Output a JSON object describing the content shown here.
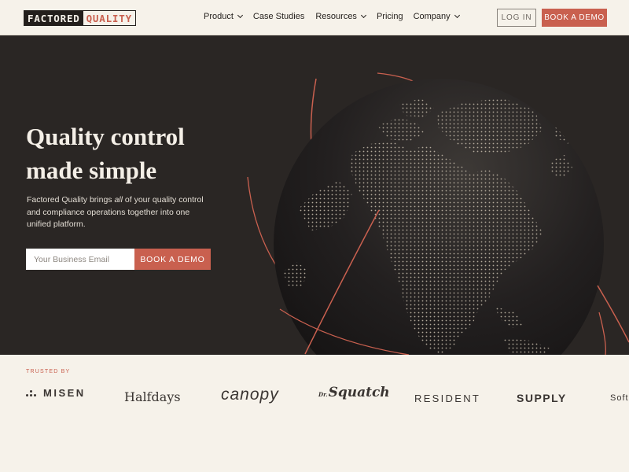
{
  "header": {
    "logo_part1": "FACTORED",
    "logo_part2": "QUALITY",
    "nav": [
      {
        "label": "Product",
        "dropdown": true
      },
      {
        "label": "Case Studies",
        "dropdown": false
      },
      {
        "label": "Resources",
        "dropdown": true
      },
      {
        "label": "Pricing",
        "dropdown": false
      },
      {
        "label": "Company",
        "dropdown": true
      }
    ],
    "login_label": "LOG IN",
    "demo_label": "BOOK A DEMO"
  },
  "hero": {
    "title_line1": "Quality control",
    "title_line2": "made simple",
    "text_before": "Factored Quality brings ",
    "text_emphasis": "all",
    "text_after": " of your quality control and compliance operations together into one unified platform.",
    "email_placeholder": "Your Business Email",
    "email_value": "",
    "cta_label": "BOOK A DEMO"
  },
  "trusted": {
    "label": "TRUSTED BY",
    "brands": {
      "misen": "MISEN",
      "halfdays": "Halfdays",
      "canopy": "canopy",
      "squatch_prefix": "Dr.",
      "squatch": "Squatch",
      "resident": "RESIDENT",
      "supply": "SUPPLY",
      "soft": "Soft"
    }
  },
  "colors": {
    "accent": "#c9604f",
    "background": "#f6f2ea",
    "hero_bg": "#2a2624",
    "globe": "#1f1c1b",
    "dots": "#b2a99a"
  }
}
